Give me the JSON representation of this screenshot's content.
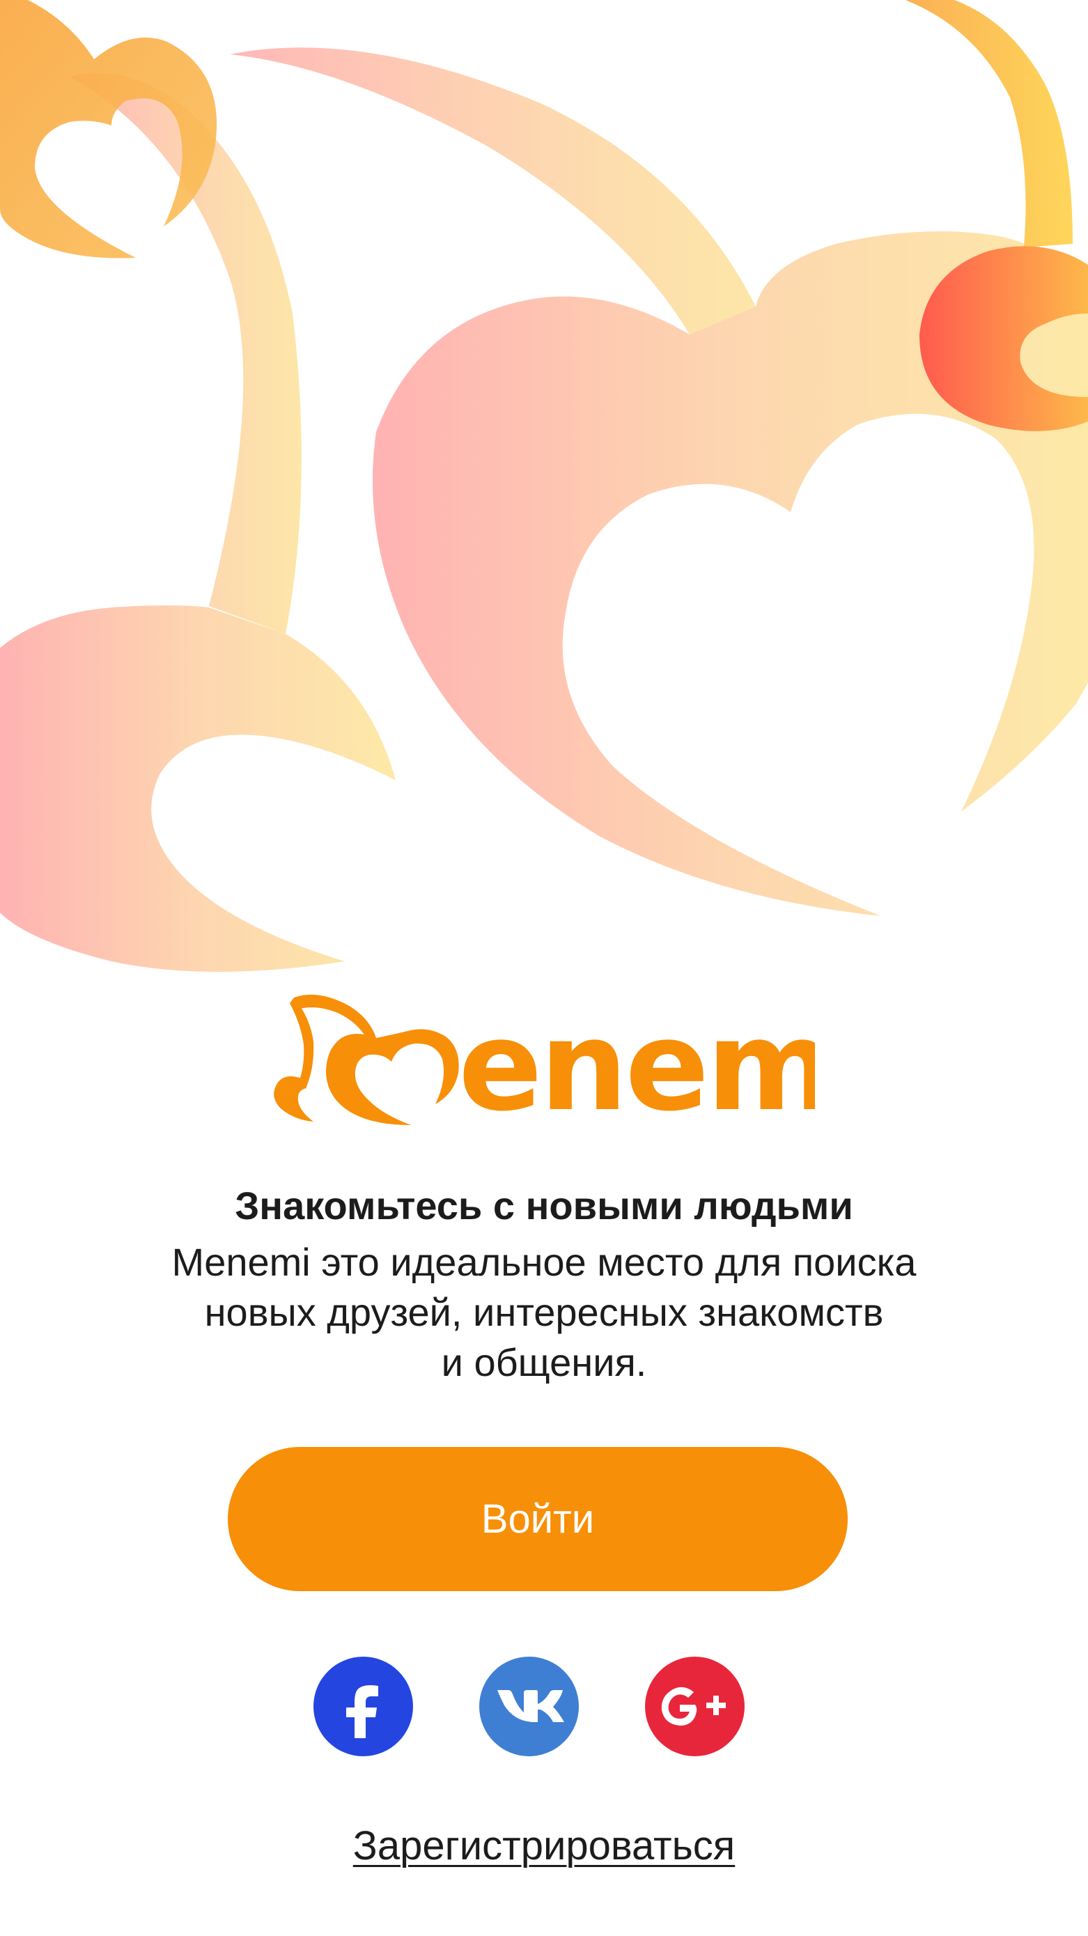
{
  "brand": {
    "name": "Menemi",
    "logo_wordmark": "enemi",
    "accent_color": "#f78f08"
  },
  "intro": {
    "headline": "Знакомьтесь с новыми людьми",
    "description_lines": [
      "Menemi это идеальное место для поиска",
      "новых друзей, интересных знакомств",
      "и общения."
    ]
  },
  "actions": {
    "login_label": "Войти",
    "register_label": "Зарегистрироваться"
  },
  "social": [
    {
      "name": "facebook",
      "icon": "facebook-icon",
      "color": "#2545e0"
    },
    {
      "name": "vk",
      "icon": "vk-icon",
      "color": "#3e7fd4"
    },
    {
      "name": "google-plus",
      "icon": "google-plus-icon",
      "color": "#e8263b"
    }
  ]
}
